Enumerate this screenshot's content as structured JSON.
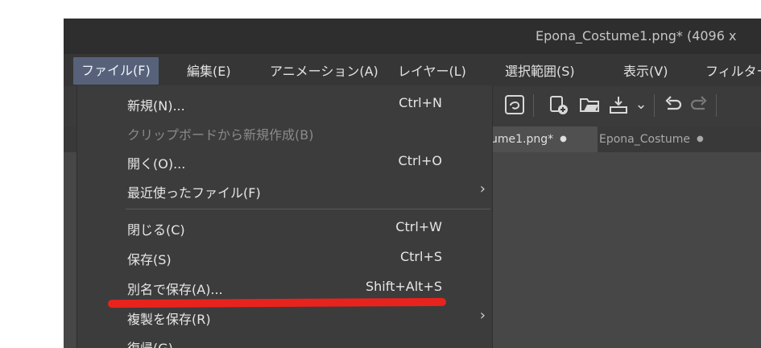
{
  "window": {
    "title": "Epona_Costume1.png* (4096 x"
  },
  "menubar": {
    "items": [
      {
        "label": "ファイル(F)"
      },
      {
        "label": "編集(E)"
      },
      {
        "label": "アニメーション(A)"
      },
      {
        "label": "レイヤー(L)"
      },
      {
        "label": "選択範囲(S)"
      },
      {
        "label": "表示(V)"
      },
      {
        "label": "フィルター"
      }
    ]
  },
  "tabs": [
    {
      "label": "ume1.png*",
      "dot": "●"
    },
    {
      "label": "Epona_Costume",
      "dot": "●"
    }
  ],
  "toolbar": {
    "icons": [
      "lasso-icon",
      "new-layer-icon",
      "open-folder-icon",
      "export-icon",
      "chevron-down-icon",
      "undo-icon",
      "redo-icon"
    ],
    "chevron": "⌄"
  },
  "file_menu": {
    "items": [
      {
        "label": "新規(N)...",
        "shortcut": "Ctrl+N"
      },
      {
        "label": "クリップボードから新規作成(B)",
        "shortcut": ""
      },
      {
        "label": "開く(O)...",
        "shortcut": "Ctrl+O"
      },
      {
        "label": "最近使ったファイル(F)",
        "shortcut": "",
        "submenu": "›"
      },
      {
        "label": "閉じる(C)",
        "shortcut": "Ctrl+W"
      },
      {
        "label": "保存(S)",
        "shortcut": "Ctrl+S"
      },
      {
        "label": "別名で保存(A)...",
        "shortcut": "Shift+Alt+S"
      },
      {
        "label": "複製を保存(R)",
        "shortcut": "",
        "submenu": "›"
      },
      {
        "label": "復帰(G)",
        "shortcut": ""
      }
    ]
  },
  "colors": {
    "menu_active_bg": "#57627a",
    "highlight_underline": "#e8231d"
  }
}
